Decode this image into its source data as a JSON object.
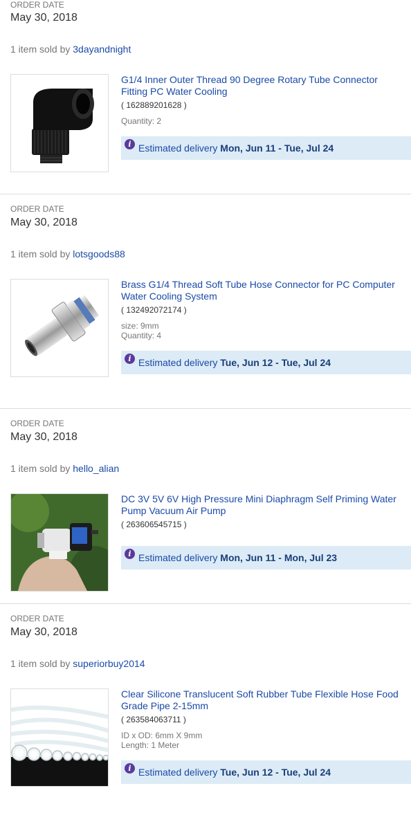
{
  "orders": [
    {
      "date_label": "ORDER DATE",
      "date": "May 30, 2018",
      "sold_prefix": "1 item sold by",
      "seller": "3dayandnight",
      "item": {
        "title_line1": "G1/4 Inner Outer Thread 90 Degree Rotary Tube Connector",
        "title_line2": "Fitting PC Water Cooling",
        "id": "( 162889201628 )",
        "quantity": "Quantity: 2"
      },
      "delivery_prefix": "Estimated delivery",
      "delivery_range": "Mon, Jun 11 - Tue, Jul 24"
    },
    {
      "date_label": "ORDER DATE",
      "date": "May 30, 2018",
      "sold_prefix": "1 item sold by",
      "seller": "lotsgoods88",
      "item": {
        "title_line1": "Brass G1/4 Thread Soft Tube Hose Connector for PC Computer",
        "title_line2": "Water Cooling System",
        "id": "( 132492072174 )",
        "size": "size: 9mm",
        "quantity": "Quantity: 4"
      },
      "delivery_prefix": "Estimated delivery",
      "delivery_range": "Tue, Jun 12 - Tue, Jul 24"
    },
    {
      "date_label": "ORDER DATE",
      "date": "May 30, 2018",
      "sold_prefix": "1 item sold by",
      "seller": "hello_alian",
      "item": {
        "title_line1": "DC 3V 5V 6V High Pressure Mini Diaphragm Self Priming Water",
        "title_line2": "Pump Vacuum Air Pump",
        "id": "( 263606545715 )"
      },
      "delivery_prefix": "Estimated delivery",
      "delivery_range": "Mon, Jun 11 - Mon, Jul 23"
    },
    {
      "date_label": "ORDER DATE",
      "date": "May 30, 2018",
      "sold_prefix": "1 item sold by",
      "seller": "superiorbuy2014",
      "item": {
        "title_line1": "Clear Silicone Translucent Soft Rubber Tube Flexible Hose Food",
        "title_line2": "Grade Pipe 2-15mm",
        "id": "( 263584063711 )",
        "spec1": "ID x OD: 6mm X 9mm",
        "spec2": "Length: 1 Meter"
      },
      "delivery_prefix": "Estimated delivery",
      "delivery_range": "Tue, Jun 12 - Tue, Jul 24"
    }
  ],
  "colors": {
    "link": "#1a4aa6",
    "delivery_bg": "#dcebf6",
    "info_icon": "#5b3a9b",
    "separator": "#dddddd"
  }
}
